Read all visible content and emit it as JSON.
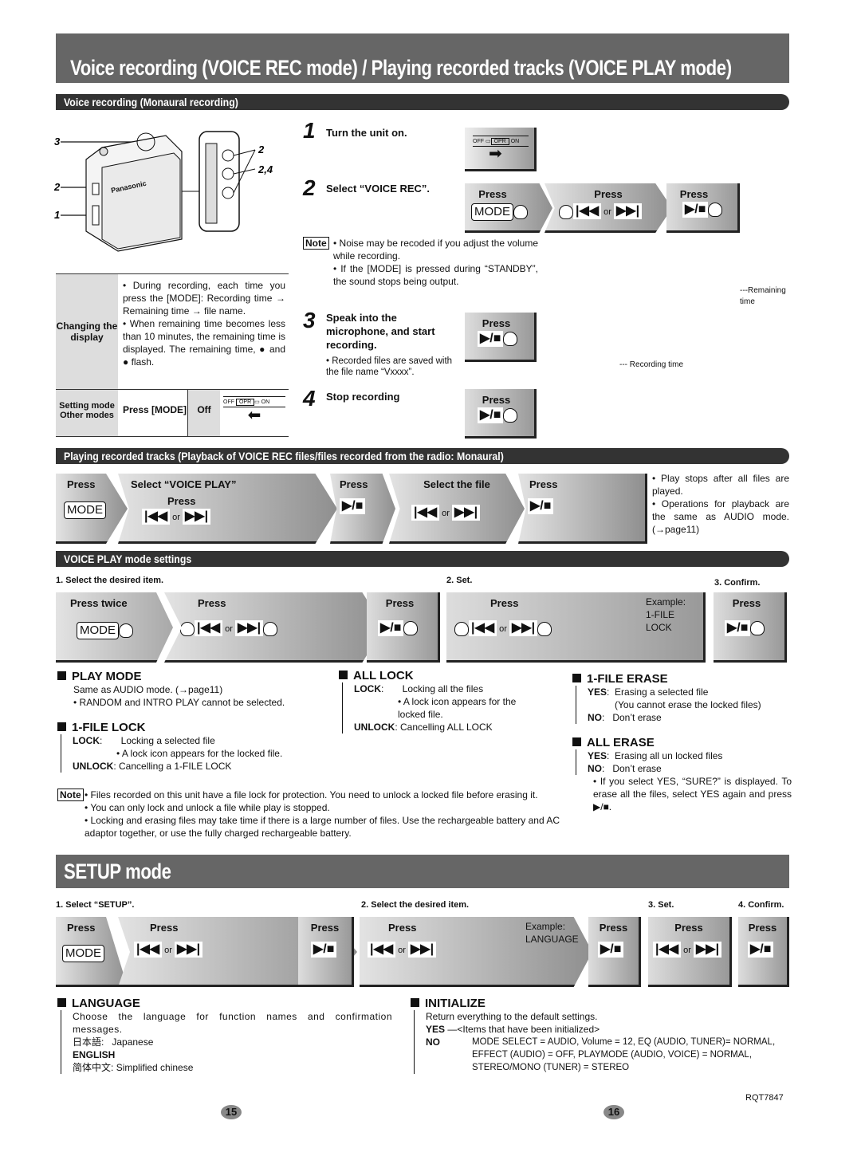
{
  "title": "Voice recording (VOICE REC mode) / Playing recorded tracks (VOICE PLAY mode)",
  "voice_rec": {
    "section_title": "Voice recording (Monaural recording)",
    "device": {
      "brand": "Panasonic",
      "callouts": [
        "3",
        "2",
        "1",
        "2",
        "2,4"
      ]
    },
    "steps": [
      {
        "num": "1",
        "text": "Turn the unit on."
      },
      {
        "num": "2",
        "text": "Select “VOICE REC”."
      },
      {
        "num": "3",
        "text": "Speak into the microphone, and start recording.",
        "bullet": "• Recorded files are saved with the file name “Vxxxx”."
      },
      {
        "num": "4",
        "text": "Stop recording"
      }
    ],
    "switch": {
      "off": "OFF",
      "opr": "OPR",
      "on": "ON"
    },
    "press": "Press",
    "mode_key": "MODE",
    "or": "or",
    "note_label": "Note",
    "notes": [
      "• Noise may be recoded if you adjust the volume while recording.",
      "• If the [MODE] is pressed during “STANDBY”, the sound stops being output."
    ],
    "display_labels": {
      "remaining": "Remaining time",
      "recording": "Recording time"
    },
    "table": {
      "row1_label": "Changing the display",
      "row1_bullets": [
        "• During recording, each time you press the [MODE]: Recording time → Remaining time → file name.",
        "• When remaining time becomes less than 10 minutes, the remaining time is displayed. The remaining time, ● and ● flash."
      ],
      "row2_label_1": "Setting mode",
      "row2_label_2": "Other modes",
      "row2_press": "Press [MODE]",
      "row2_off": "Off"
    }
  },
  "playback": {
    "section_title": "Playing recorded tracks (Playback of VOICE REC files/files recorded from the radio: Monaural)",
    "steps": [
      "Press",
      "Select “VOICE PLAY”",
      "Press",
      "Select the file",
      "Press"
    ],
    "sub_press": "Press",
    "notes": [
      "• Play stops after all files are played.",
      "• Operations for playback are the same as AUDIO mode. (→page11)"
    ]
  },
  "voice_play_settings": {
    "section_title": "VOICE PLAY mode settings",
    "step_labels": [
      "1. Select the desired item.",
      "2. Set.",
      "3. Confirm."
    ],
    "boxes": [
      "Press twice",
      "Press",
      "Press",
      "Press",
      "Press"
    ],
    "example": "Example:\n1-FILE\nLOCK",
    "items": [
      {
        "heading": "PLAY MODE",
        "lines": [
          "Same as AUDIO mode. (→page11)",
          "• RANDOM and INTRO PLAY cannot be selected."
        ]
      },
      {
        "heading": "1-FILE LOCK",
        "options": [
          {
            "key": "LOCK",
            "desc": "Locking a selected file",
            "sub": "• A lock icon     appears for the locked file."
          },
          {
            "key": "UNLOCK",
            "desc": "Cancelling a 1-FILE LOCK"
          }
        ]
      },
      {
        "heading": "ALL LOCK",
        "options": [
          {
            "key": "LOCK",
            "desc": "Locking all the files",
            "sub": "• A lock icon     appears for the locked file."
          },
          {
            "key": "UNLOCK",
            "desc": "Cancelling ALL LOCK"
          }
        ]
      },
      {
        "heading": "1-FILE ERASE",
        "options": [
          {
            "key": "YES",
            "desc": "Erasing a selected file",
            "sub": "(You cannot erase the locked files)"
          },
          {
            "key": "NO",
            "desc": "Don’t erase"
          }
        ]
      },
      {
        "heading": "ALL ERASE",
        "options": [
          {
            "key": "YES",
            "desc": "Erasing all un locked files"
          },
          {
            "key": "NO",
            "desc": "Don’t erase"
          }
        ],
        "note": "• If you select YES, “SURE?” is displayed. To erase all the files, select YES again and press ▶/■."
      }
    ],
    "notes": [
      "• Files recorded on this unit have a file lock for protection. You need to unlock a locked file before erasing it.",
      "• You can only lock and unlock a file while play is stopped.",
      "• Locking and erasing files may take time if there is a large number of files. Use the rechargeable battery and AC adaptor together, or use the fully charged rechargeable battery."
    ]
  },
  "setup": {
    "title": "SETUP mode",
    "step_labels": [
      "1. Select “SETUP”.",
      "2. Select the desired item.",
      "3. Set.",
      "4. Confirm."
    ],
    "boxes": [
      "Press",
      "Press",
      "Press",
      "Press",
      "Press",
      "Press",
      "Press"
    ],
    "example": "Example:\nLANGUAGE",
    "language": {
      "heading": "LANGUAGE",
      "desc": "Choose the language for function names and confirmation messages.",
      "options": [
        {
          "key": "日本語:",
          "desc": "Japanese"
        },
        {
          "key": "ENGLISH",
          "desc": ""
        },
        {
          "key": "简体中文:",
          "desc": "Simplified chinese"
        }
      ]
    },
    "initialize": {
      "heading": "INITIALIZE",
      "desc": "Return everything to the default settings.",
      "yes": "YES",
      "yes_desc": "<Items that have been initialized>",
      "no": "NO",
      "items_line1": "MODE SELECT = AUDIO, Volume = 12, EQ (AUDIO, TUNER)= NORMAL,",
      "items_line2": "EFFECT (AUDIO) = OFF,  PLAYMODE (AUDIO, VOICE) = NORMAL,",
      "items_line3": "STEREO/MONO (TUNER) = STEREO"
    }
  },
  "footer": {
    "doc_code": "RQT7847",
    "page_left": "15",
    "page_right": "16"
  }
}
